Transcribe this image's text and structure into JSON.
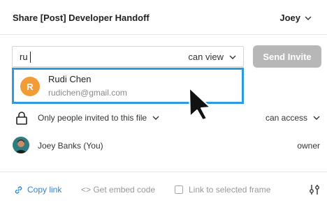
{
  "header": {
    "title": "Share [Post] Developer Handoff",
    "user": "Joey",
    "user_menu_icon": "chevron-down-icon"
  },
  "invite": {
    "input_value": "ru",
    "permission": "can view",
    "permission_icon": "chevron-down-icon",
    "send_label": "Send Invite",
    "send_bg": "#b7b7b7"
  },
  "suggestion": {
    "initial": "R",
    "name": "Rudi Chen",
    "email": "rudichen@gmail.com",
    "avatar_color": "#f29c38",
    "highlight_color": "#2d9be0"
  },
  "access": {
    "icon": "lock-icon",
    "scope": "Only people invited to this file",
    "permission": "can access"
  },
  "members": [
    {
      "name": "Joey Banks (You)",
      "role": "owner"
    }
  ],
  "footer": {
    "copy_link": "Copy link",
    "copy_color": "#2d86d8",
    "embed": "<> Get embed code",
    "frame": "Link to selected frame",
    "settings_icon": "sliders-icon"
  }
}
